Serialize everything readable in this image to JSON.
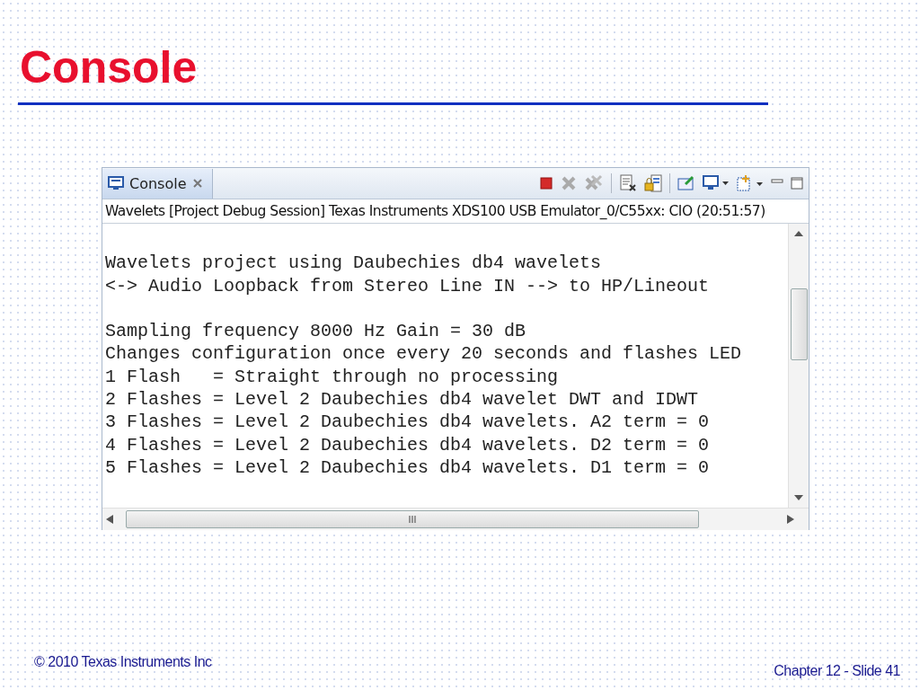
{
  "slide": {
    "title": "Console"
  },
  "console": {
    "tab": {
      "label": "Console",
      "selected": true
    },
    "session": "Wavelets [Project Debug Session] Texas Instruments XDS100 USB Emulator_0/C55xx: CIO (20:51:57)",
    "paragraphs": [
      {
        "lines": [
          "Wavelets project using Daubechies db4 wavelets",
          "<-> Audio Loopback from Stereo Line IN --> to HP/Lineout"
        ]
      },
      {
        "lines": [
          "Sampling frequency 8000 Hz Gain = 30 dB",
          "Changes configuration once every 20 seconds and flashes LED",
          "1 Flash   = Straight through no processing",
          "2 Flashes = Level 2 Daubechies db4 wavelet DWT and IDWT",
          "3 Flashes = Level 2 Daubechies db4 wavelets. A2 term = 0",
          "4 Flashes = Level 2 Daubechies db4 wavelets. D2 term = 0",
          "5 Flashes = Level 2 Daubechies db4 wavelets. D1 term = 0"
        ]
      }
    ],
    "scroll_thumb": "III"
  },
  "footer": {
    "copyright": "© 2010 Texas Instruments Inc",
    "slide_number": "Chapter 12 - Slide 41"
  }
}
